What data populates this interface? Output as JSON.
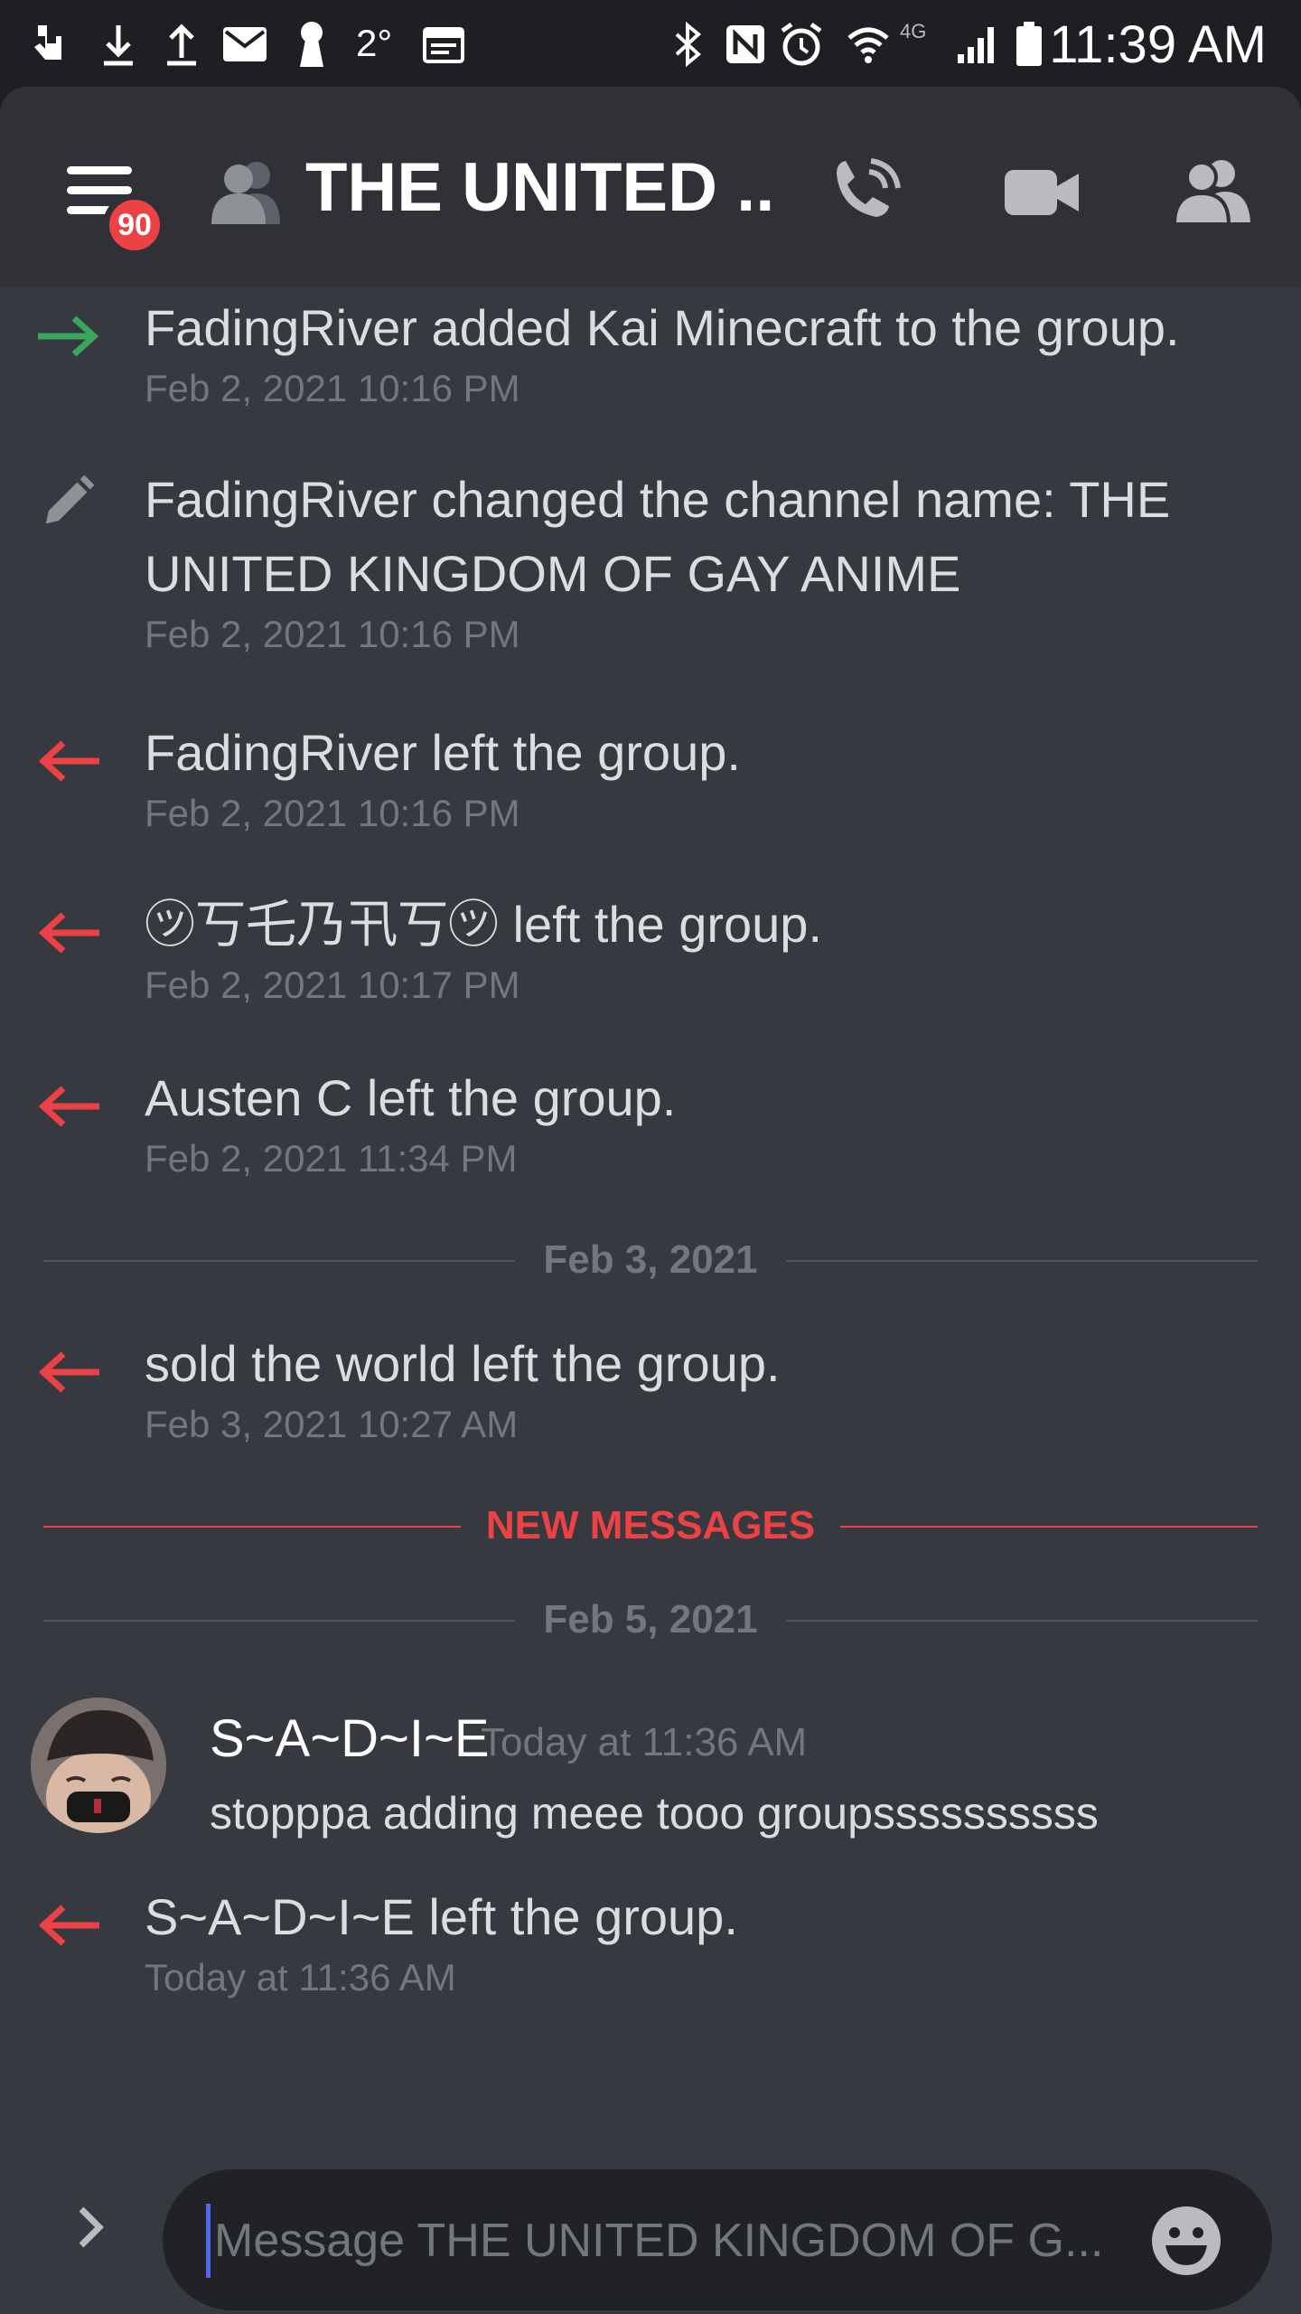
{
  "status_bar": {
    "temperature": "2°",
    "network": "4G",
    "time": "11:39 AM"
  },
  "header": {
    "unread_badge": "90",
    "channel_title": "THE UNITED ..."
  },
  "messages": [
    {
      "type": "join",
      "text": "FadingRiver added Kai Minecraft to the group.",
      "time": "Feb 2, 2021 10:16 PM"
    },
    {
      "type": "rename",
      "text": "FadingRiver changed the channel name: THE UNITED KINGDOM OF GAY ANIME",
      "time": "Feb 2, 2021 10:16 PM"
    },
    {
      "type": "leave",
      "text": "FadingRiver left the group.",
      "time": "Feb 2, 2021 10:16 PM"
    },
    {
      "type": "leave",
      "text": "㋡丂乇乃卂丂㋡ left the group.",
      "time": "Feb 2, 2021 10:17 PM"
    },
    {
      "type": "leave",
      "text": "Austen C left the group.",
      "time": "Feb 2, 2021 11:34 PM"
    },
    {
      "type": "leave",
      "text": "sold the world left the group.",
      "time": "Feb 3, 2021 10:27 AM"
    },
    {
      "type": "leave",
      "text": "S~A~D~I~E left the group.",
      "time": "Today at 11:36 AM"
    }
  ],
  "dividers": {
    "feb3": "Feb 3, 2021",
    "new_messages": "NEW MESSAGES",
    "feb5": "Feb 5, 2021"
  },
  "user_message": {
    "author": "S~A~D~I~E",
    "time": "Today at 11:36 AM",
    "text": "stopppa adding meee tooo groupssssssssss"
  },
  "input": {
    "placeholder": "Message THE UNITED KINGDOM OF G...",
    "value": ""
  },
  "colors": {
    "background": "#36393f",
    "header": "#2f3136",
    "join_arrow": "#3ba55d",
    "leave_arrow": "#ed4245",
    "new_messages": "#ed4245",
    "badge": "#ed4245"
  }
}
